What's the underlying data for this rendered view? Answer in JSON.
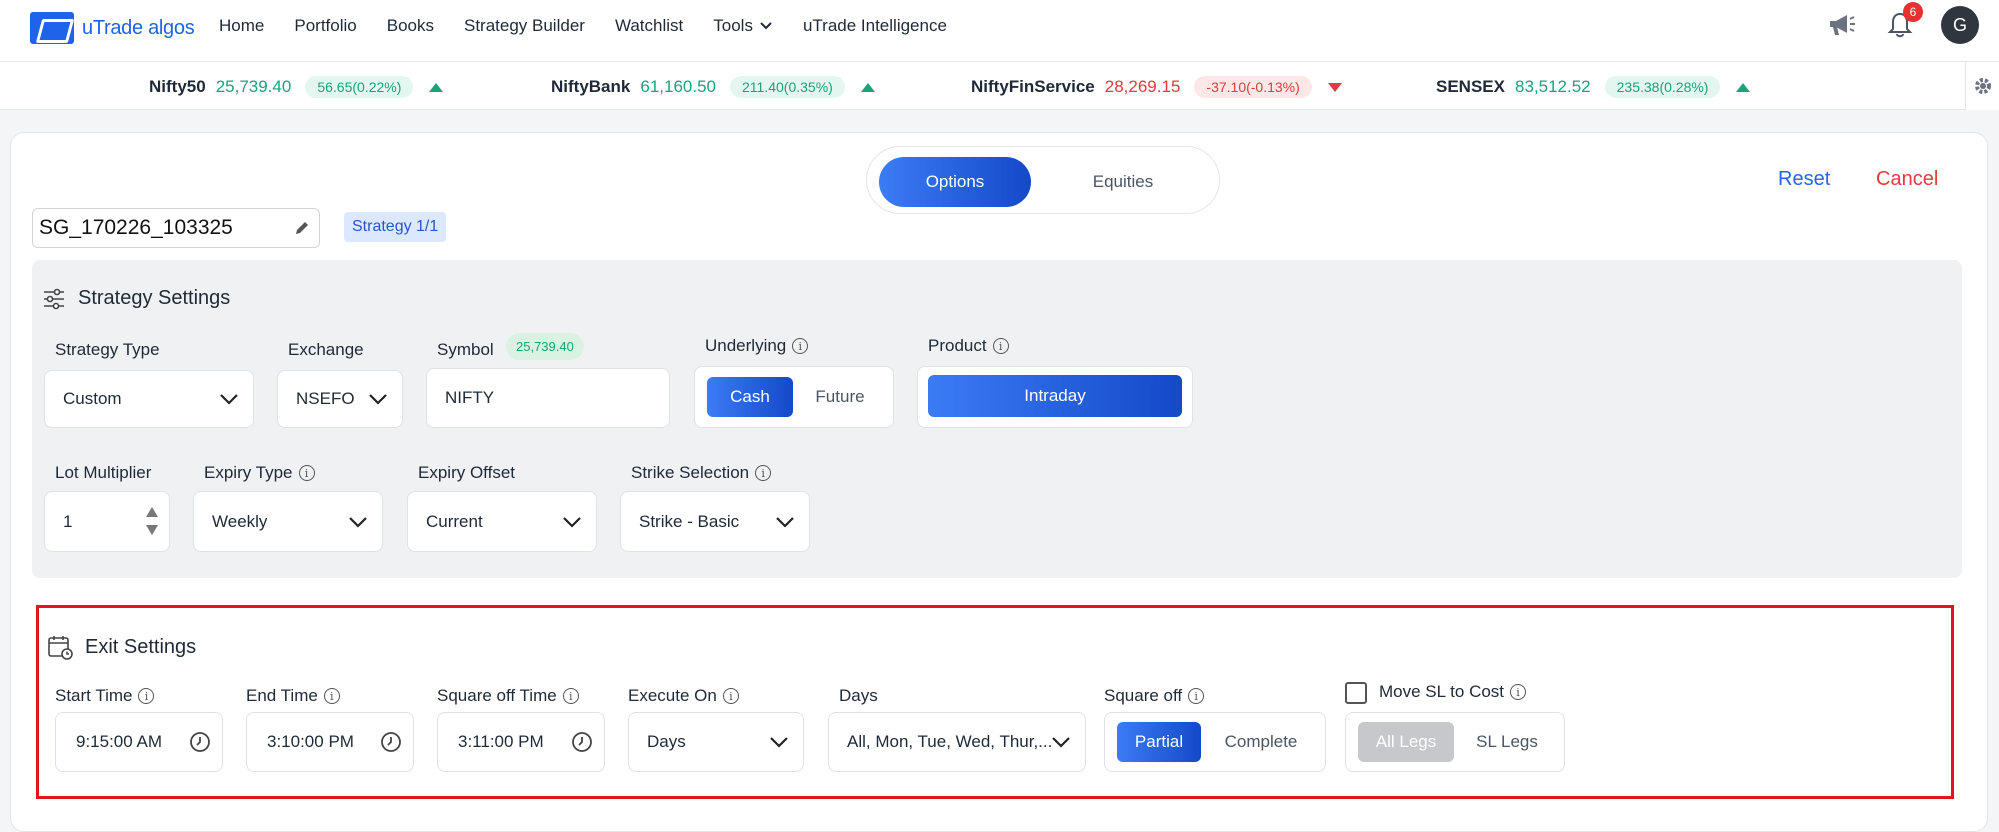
{
  "brand": {
    "name": "uTrade algos"
  },
  "nav": {
    "items": [
      "Home",
      "Portfolio",
      "Books",
      "Strategy Builder",
      "Watchlist",
      "Tools",
      "uTrade Intelligence"
    ]
  },
  "header": {
    "notification_count": "6",
    "avatar_letter": "G"
  },
  "ticker": [
    {
      "name": "Nifty50",
      "price": "25,739.40",
      "change": "56.65(0.22%)",
      "direction": "up"
    },
    {
      "name": "NiftyBank",
      "price": "61,160.50",
      "change": "211.40(0.35%)",
      "direction": "up"
    },
    {
      "name": "NiftyFinService",
      "price": "28,269.15",
      "change": "-37.10(-0.13%)",
      "direction": "down"
    },
    {
      "name": "SENSEX",
      "price": "83,512.52",
      "change": "235.38(0.28%)",
      "direction": "up"
    }
  ],
  "segment": {
    "options": "Options",
    "equities": "Equities",
    "selected": "Options"
  },
  "actions": {
    "reset": "Reset",
    "cancel": "Cancel"
  },
  "strategy": {
    "name": "SG_170226_103325",
    "tag": "Strategy 1/1"
  },
  "strategy_settings": {
    "title": "Strategy Settings",
    "strategy_type": {
      "label": "Strategy Type",
      "value": "Custom"
    },
    "exchange": {
      "label": "Exchange",
      "value": "NSEFO"
    },
    "symbol": {
      "label": "Symbol",
      "value": "NIFTY",
      "ltp": "25,739.40"
    },
    "underlying": {
      "label": "Underlying",
      "options": [
        "Cash",
        "Future"
      ],
      "selected": "Cash"
    },
    "product": {
      "label": "Product",
      "value": "Intraday"
    },
    "lot_multiplier": {
      "label": "Lot Multiplier",
      "value": "1"
    },
    "expiry_type": {
      "label": "Expiry Type",
      "value": "Weekly"
    },
    "expiry_offset": {
      "label": "Expiry Offset",
      "value": "Current"
    },
    "strike_selection": {
      "label": "Strike Selection",
      "value": "Strike - Basic"
    }
  },
  "exit_settings": {
    "title": "Exit Settings",
    "start_time": {
      "label": "Start Time",
      "value": "9:15:00 AM"
    },
    "end_time": {
      "label": "End Time",
      "value": "3:10:00 PM"
    },
    "square_off_time": {
      "label": "Square off Time",
      "value": "3:11:00 PM"
    },
    "execute_on": {
      "label": "Execute On",
      "value": "Days"
    },
    "days": {
      "label": "Days",
      "value": "All, Mon, Tue, Wed, Thur,..."
    },
    "square_off": {
      "label": "Square off",
      "options": [
        "Partial",
        "Complete"
      ],
      "selected": "Partial"
    },
    "move_sl": {
      "label": "Move SL to Cost",
      "options": [
        "All Legs",
        "SL Legs"
      ],
      "checked": false
    }
  },
  "colors": {
    "accent": "#1e63e9",
    "up": "#1aa37a",
    "down": "#e23b3b",
    "highlight_border": "#e0151f"
  }
}
